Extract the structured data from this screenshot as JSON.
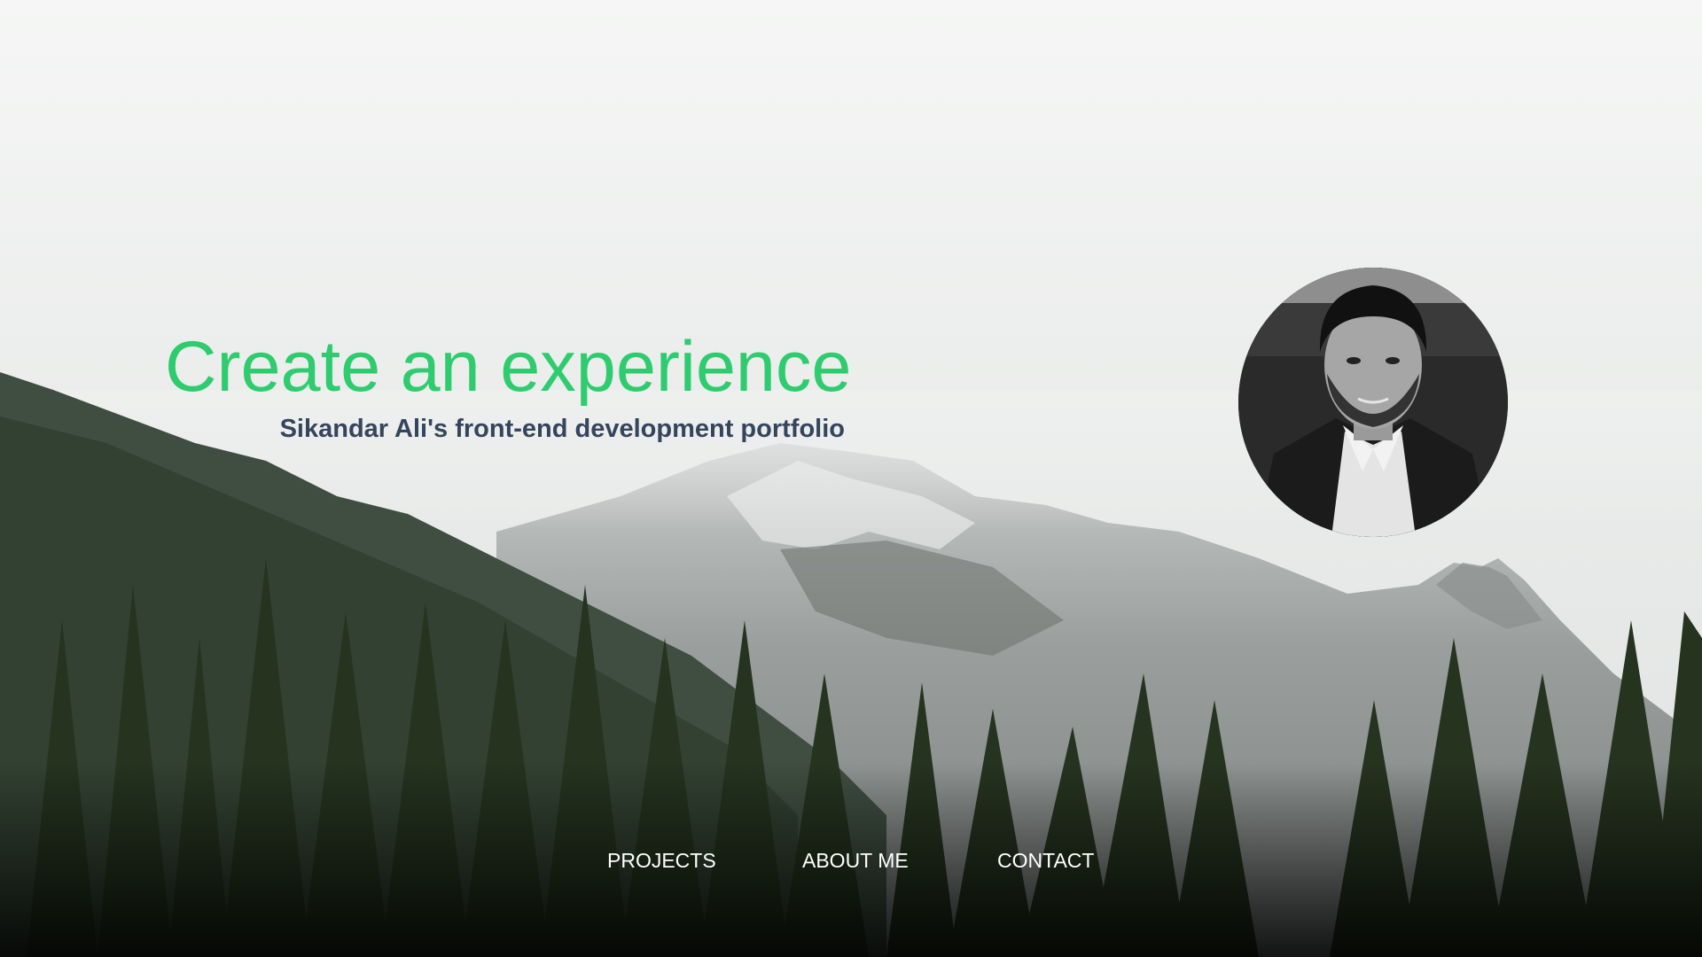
{
  "hero": {
    "title": "Create an experience",
    "subtitle": "Sikandar Ali's front-end development portfolio"
  },
  "nav": {
    "projects": "PROJECTS",
    "about": "ABOUT ME",
    "contact": "CONTACT"
  },
  "colors": {
    "title": "#2ecc6e",
    "subtitle": "#34455c",
    "nav_text": "#ffffff"
  },
  "images": {
    "background": "misty-mountain-forest",
    "profile": "grayscale-portrait"
  }
}
